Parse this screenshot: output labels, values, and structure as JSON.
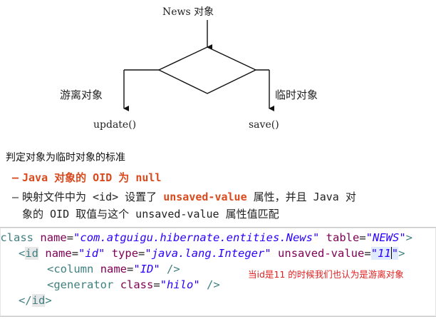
{
  "flow": {
    "top_node": "News 对象",
    "left_branch": "游离对象",
    "right_branch": "临时对象",
    "left_result": "update()",
    "right_result": "save()"
  },
  "heading": "判定对象为临时对象的标准",
  "bullets": [
    {
      "dash": "–",
      "text": "Java 对象的 OID 为 null"
    },
    {
      "dash": "–",
      "line1_pre": "映射文件中为 <id> 设置了 ",
      "line1_key": "unsaved-value",
      "line1_post": " 属性，并且 Java 对",
      "line2": "象的 OID 取值与这个 unsaved-value 属性值匹配"
    }
  ],
  "code": {
    "line1": {
      "lt": "<",
      "tag": "class",
      "a1": "name",
      "eq1": "=",
      "v1": "\"com.atguigu.hibernate.entities.News\"",
      "a2": "table",
      "eq2": "=",
      "v2": "\"NEWS\"",
      "gt": ">"
    },
    "line2": {
      "lt": "<",
      "tag": "id",
      "a1": "name",
      "eq1": "=",
      "v1": "\"id\"",
      "a2": "type",
      "eq2": "=",
      "v2": "\"java.lang.Integer\"",
      "a3": "unsaved-value",
      "eq3": "=",
      "v3_open": "\"",
      "v3_val": "11",
      "v3_close": "\"",
      "gt": ">"
    },
    "line3": {
      "lt": "<",
      "tag": "column",
      "a1": "name",
      "eq1": "=",
      "v1": "\"ID\"",
      "end": " />"
    },
    "line4": {
      "lt": "<",
      "tag": "generator",
      "a1": "class",
      "eq1": "=",
      "v1": "\"hilo\"",
      "end": " />"
    },
    "line5": {
      "lt": "</",
      "tag": "id",
      "gt": ">"
    }
  },
  "annotation": "当id是11 的时候我们也认为是游离对象",
  "colors": {
    "accent_red": "#d94a1e",
    "annotation_red": "#e02020",
    "xml_tag": "#3f7f7f",
    "xml_attr": "#7f0055",
    "xml_value": "#2a00ff"
  }
}
